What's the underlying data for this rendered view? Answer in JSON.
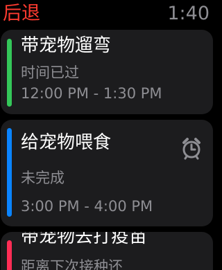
{
  "header": {
    "back_label": "后退",
    "time": "1:40"
  },
  "colors": {
    "back": "#ff3b30",
    "card_background": "#1c1c1e",
    "secondary_text": "#8e8e93",
    "completed_bar": "#34c759",
    "active_bar": "#0a84ff",
    "upcoming_bar": "#ff2d55"
  },
  "reminders": [
    {
      "title": "带宠物遛弯",
      "status": "时间已过",
      "time_range": "12:00 PM - 1:30 PM",
      "bar_color": "green"
    },
    {
      "title": "给宠物喂食",
      "status": "未完成",
      "time_range": "3:00 PM - 4:00 PM",
      "bar_color": "blue",
      "icon": "alarm-clock-icon"
    },
    {
      "title": "带宠物去打疫苗",
      "status": "距离下次接种还",
      "bar_color": "red"
    }
  ]
}
